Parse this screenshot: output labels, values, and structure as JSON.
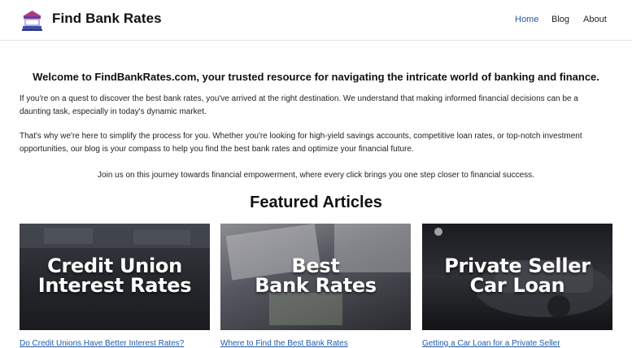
{
  "header": {
    "site_title": "Find Bank Rates",
    "logo_icon": "bank-logo-icon",
    "nav": [
      {
        "label": "Home",
        "active": true
      },
      {
        "label": "Blog",
        "active": false
      },
      {
        "label": "About",
        "active": false
      }
    ]
  },
  "intro": {
    "welcome": "Welcome to FindBankRates.com, your trusted resource for navigating the intricate world of banking and finance.",
    "paragraph1": "If you're on a quest to discover the best bank rates, you've arrived at the right destination. We understand that making informed financial decisions can be a daunting task, especially in today's dynamic market.",
    "paragraph2": "That's why we're here to simplify the process for you. Whether you're looking for high-yield savings accounts, competitive loan rates, or top-notch investment opportunities, our blog is your compass to help you find the best bank rates and optimize your financial future.",
    "paragraph3": "Join us on this journey towards financial empowerment, where every click brings you one step closer to financial success."
  },
  "featured": {
    "title": "Featured Articles",
    "articles": [
      {
        "image_line1": "Credit Union",
        "image_line2": "Interest Rates",
        "link": "Do Credit Unions Have Better Interest Rates?"
      },
      {
        "image_line1": "Best",
        "image_line2": "Bank Rates",
        "link": "Where to Find the Best Bank Rates"
      },
      {
        "image_line1": "Private Seller",
        "image_line2": "Car Loan",
        "link": "Getting a Car Loan for a Private Seller"
      }
    ]
  },
  "colors": {
    "link": "#1f5aa6",
    "nav_active": "#1f5aa6",
    "text": "#222222"
  }
}
